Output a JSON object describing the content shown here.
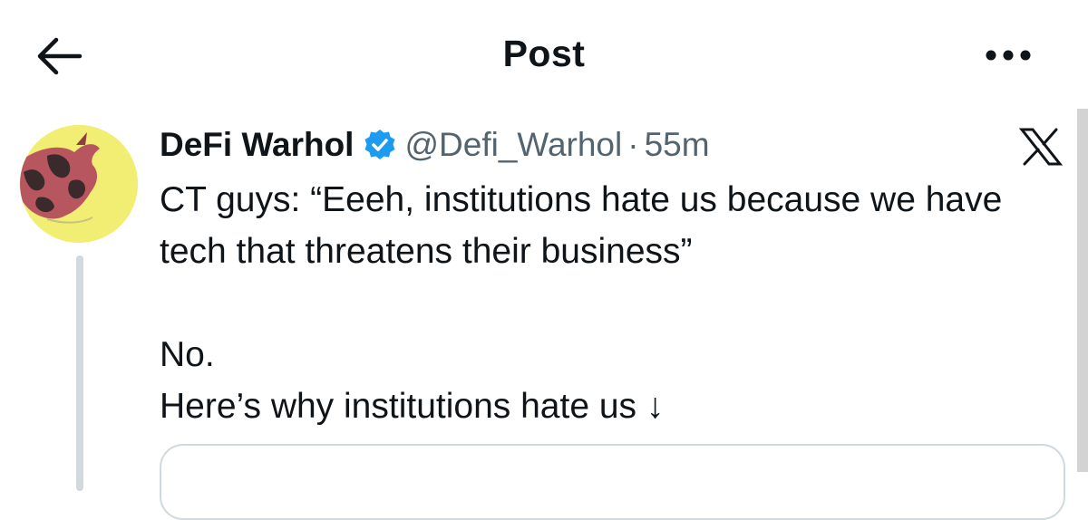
{
  "header": {
    "title": "Post",
    "back_icon": "arrow-left-icon",
    "more_icon": "more-horizontal-icon"
  },
  "tweet": {
    "author": {
      "display_name": "DeFi Warhol",
      "handle": "@Defi_Warhol",
      "verified": true
    },
    "separator": "·",
    "time": "55m",
    "text": "CT guys: “Eeeh, institutions hate us because we have tech that threatens their business”\n\nNo.\nHere’s why institutions hate us ↓",
    "brand_icon": "x-logo-icon"
  },
  "colors": {
    "text": "#0f1419",
    "secondary": "#536471",
    "verified": "#1d9bf0",
    "avatar_bg": "#f1ee73",
    "border": "#cfd9de"
  }
}
